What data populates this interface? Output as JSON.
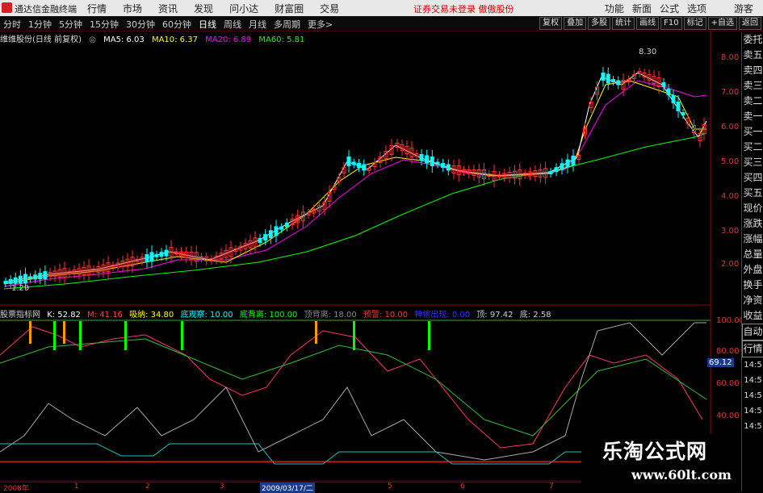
{
  "app": {
    "title": "通达信金融终端",
    "login_notice": "证券交易未登录 傲傲股份"
  },
  "menus": [
    "行情",
    "市场",
    "资讯",
    "发现",
    "问小达",
    "财富圈",
    "交易"
  ],
  "right_menus": [
    "功能",
    "新面",
    "公式",
    "选项",
    "游客"
  ],
  "periods": [
    "分时",
    "1分钟",
    "5分钟",
    "15分钟",
    "30分钟",
    "60分钟",
    "日线",
    "周线",
    "月线",
    "多周期",
    "更多>"
  ],
  "active_period": "日线",
  "tools": [
    "复权",
    "叠加",
    "多股",
    "统计",
    "画线",
    "F10",
    "标记",
    "+自选",
    "返回"
  ],
  "stock": {
    "name": "维维股份(日线 前复权)",
    "ma5": "MA5: 6.03",
    "ma10": "MA10: 6.37",
    "ma20": "MA20: 6.89",
    "ma60": "MA60: 5.81"
  },
  "price_axis": [
    "8.00",
    "7.00",
    "6.00",
    "5.00",
    "4.00",
    "3.00",
    "2.00"
  ],
  "high_label": "8.30",
  "low_label": "1.29",
  "indicator": {
    "name": "股票指标网",
    "k": "K: 52.82",
    "m": "M: 41.16",
    "absorb": "吸纳: 34.80",
    "bottom_watch": "底观察: 10.00",
    "bottom_div": "底背离: 100.00",
    "top_div": "顶背离: 18.00",
    "alert": "预警: 10.00",
    "signal": "神偷出现: 0.00",
    "top": "顶: 97.42",
    "bottom": "底: 2.58"
  },
  "ind_axis": [
    "100.00",
    "80.00",
    "60.00",
    "40.00"
  ],
  "ind_value_tag": "69.12",
  "side_panel": [
    "委托",
    "卖五",
    "卖四",
    "卖三",
    "卖二",
    "卖一",
    "买一",
    "买二",
    "买三",
    "买四",
    "买五",
    "现价",
    "涨跌",
    "涨幅",
    "总量",
    "外盘",
    "换手",
    "净资",
    "收益",
    "自动",
    "行情"
  ],
  "ind_side": [
    "14:5",
    "14:5",
    "14:5",
    "14:5",
    "14:5",
    "14:5",
    "14:5"
  ],
  "dates": [
    "2008年",
    "1",
    "2",
    "3",
    "2009/03/17/二",
    "5",
    "6",
    "7"
  ],
  "watermark": {
    "title": "乐淘公式网",
    "url": "www.60lt.com"
  },
  "colors": {
    "ma5": "#ffffff",
    "ma10": "#ffff00",
    "ma20": "#ff00ff",
    "ma60": "#00ff00",
    "up": "#ff3030",
    "down": "#00ffff"
  }
}
